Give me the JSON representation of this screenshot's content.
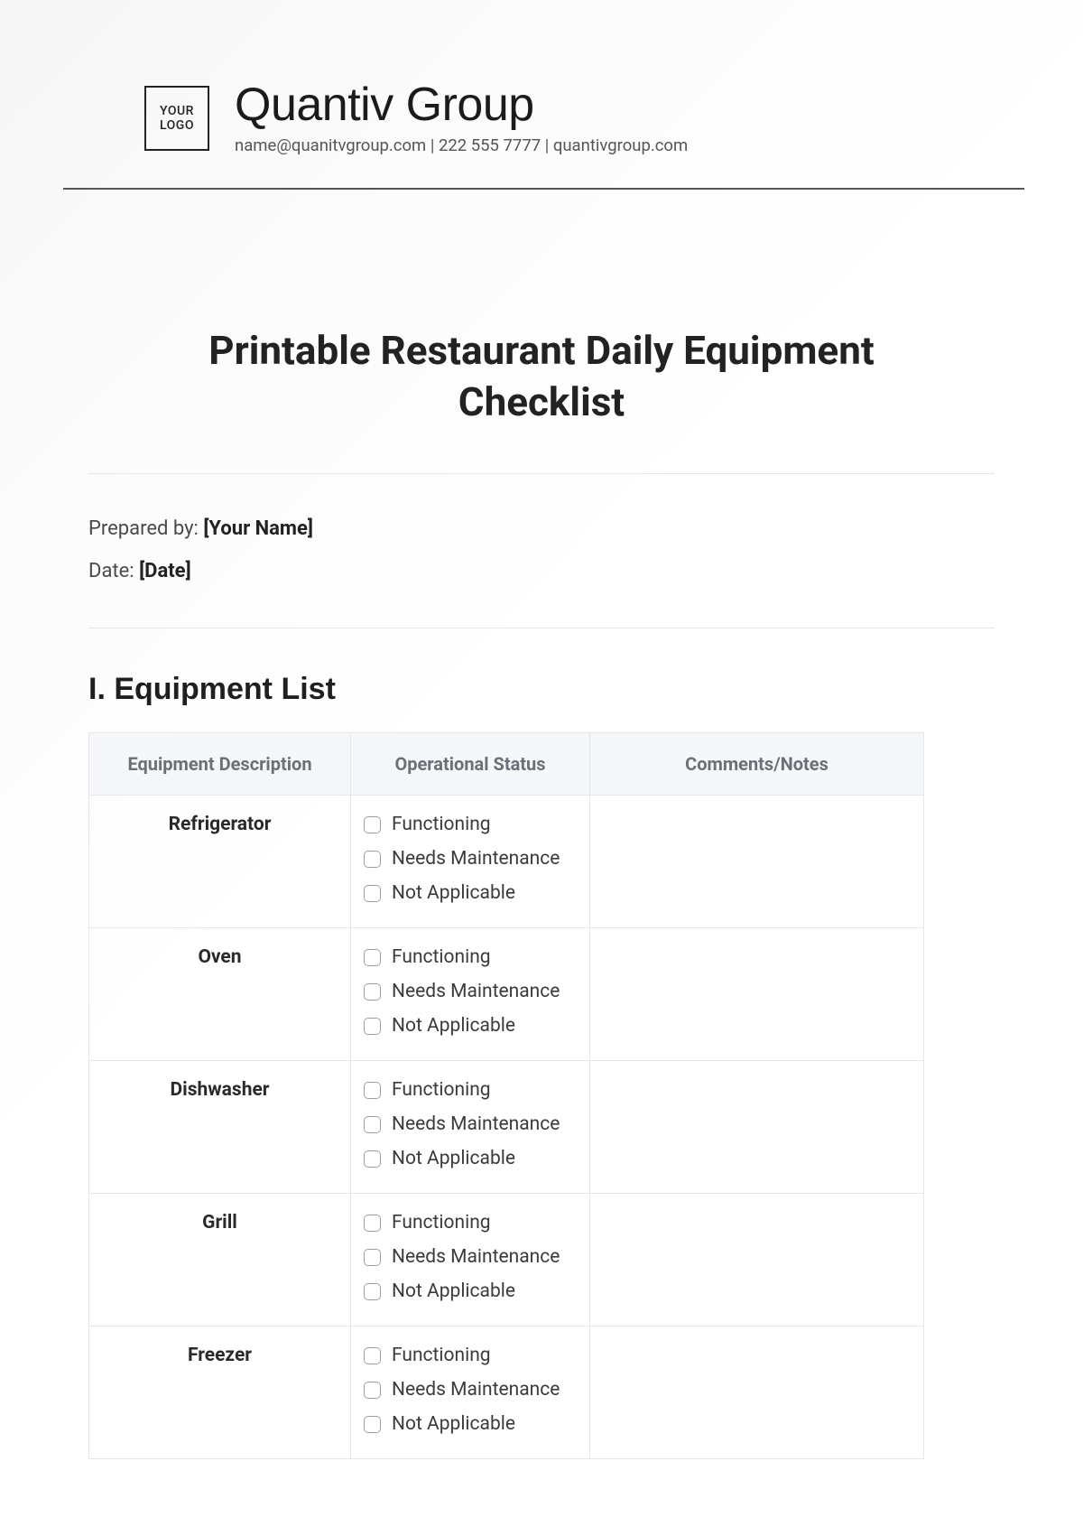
{
  "brand": {
    "logo_text": "YOUR\nLOGO",
    "name": "Quantiv Group",
    "email": "name@quanitvgroup.com",
    "phone": "222 555 7777",
    "website": "quantivgroup.com"
  },
  "document": {
    "title": "Printable Restaurant Daily Equipment Checklist",
    "prepared_by_label": "Prepared by:",
    "prepared_by_value": "[Your Name]",
    "date_label": "Date:",
    "date_value": "[Date]"
  },
  "section": {
    "equipment_list_heading": "I. Equipment List"
  },
  "table": {
    "headers": {
      "description": "Equipment Description",
      "status": "Operational Status",
      "notes": "Comments/Notes"
    },
    "status_options": {
      "functioning": "Functioning",
      "needs_maintenance": "Needs Maintenance",
      "not_applicable": "Not Applicable"
    },
    "rows": [
      {
        "equipment": "Refrigerator",
        "notes": ""
      },
      {
        "equipment": "Oven",
        "notes": ""
      },
      {
        "equipment": "Dishwasher",
        "notes": ""
      },
      {
        "equipment": "Grill",
        "notes": ""
      },
      {
        "equipment": "Freezer",
        "notes": ""
      }
    ]
  }
}
